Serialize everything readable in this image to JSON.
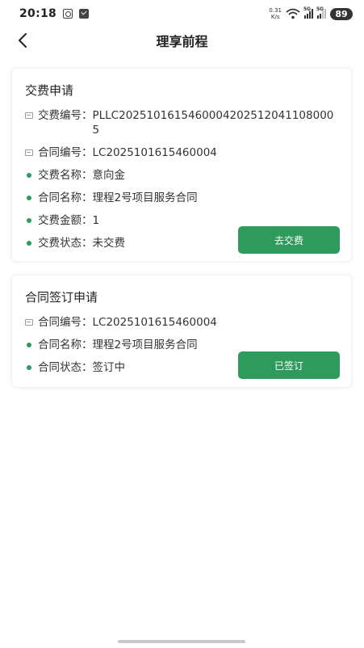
{
  "status_bar": {
    "time": "20:18",
    "speed_value": "0.31",
    "speed_unit": "K/s",
    "signal_label_1": "5G",
    "signal_label_2": "5G",
    "battery": "89"
  },
  "nav": {
    "title": "理享前程",
    "back_icon": "chevron-left-icon"
  },
  "payment_card": {
    "title": "交费申请",
    "rows": [
      {
        "icon": "doc-icon",
        "label": "交费编号：",
        "value": "PLLC20251016154600042025120411080005"
      },
      {
        "icon": "doc-icon",
        "label": "合同编号：",
        "value": "LC2025101615460004"
      },
      {
        "icon": "dot",
        "label": "交费名称：",
        "value": "意向金"
      },
      {
        "icon": "dot",
        "label": "合同名称：",
        "value": "理程2号项目服务合同"
      },
      {
        "icon": "dot",
        "label": "交费金额：",
        "value": "1"
      },
      {
        "icon": "dot",
        "label": "交费状态：",
        "value": "未交费"
      }
    ],
    "button_label": "去交费"
  },
  "contract_card": {
    "title": "合同签订申请",
    "rows": [
      {
        "icon": "doc-icon",
        "label": "合同编号：",
        "value": "LC2025101615460004"
      },
      {
        "icon": "dot",
        "label": "合同名称：",
        "value": "理程2号项目服务合同"
      },
      {
        "icon": "dot",
        "label": "合同状态：",
        "value": "签订中"
      }
    ],
    "button_label": "已签订"
  },
  "colors": {
    "accent": "#2e9b5c",
    "text": "#333333"
  }
}
